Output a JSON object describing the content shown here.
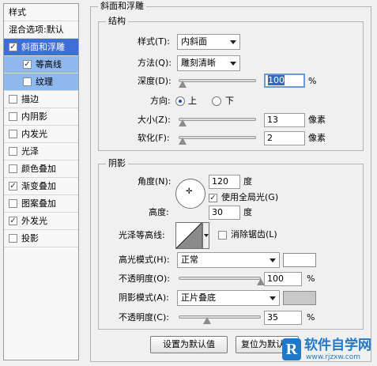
{
  "style_list": {
    "header": "样式",
    "blend_options": "混合选项:默认",
    "items": [
      {
        "label": "斜面和浮雕",
        "checked": true
      },
      {
        "label": "等高线",
        "checked": true
      },
      {
        "label": "纹理",
        "checked": false
      },
      {
        "label": "描边",
        "checked": false
      },
      {
        "label": "内阴影",
        "checked": false
      },
      {
        "label": "内发光",
        "checked": false
      },
      {
        "label": "光泽",
        "checked": false
      },
      {
        "label": "颜色叠加",
        "checked": false
      },
      {
        "label": "渐变叠加",
        "checked": true
      },
      {
        "label": "图案叠加",
        "checked": false
      },
      {
        "label": "外发光",
        "checked": true
      },
      {
        "label": "投影",
        "checked": false
      }
    ]
  },
  "panel_title": "斜面和浮雕",
  "structure": {
    "title": "结构",
    "style_label": "样式(T):",
    "style_value": "内斜面",
    "method_label": "方法(Q):",
    "method_value": "雕刻清晰",
    "depth_label": "深度(D):",
    "depth_value": "100",
    "depth_unit": "%",
    "depth_level": 0.05,
    "direction_label": "方向:",
    "dir_up": "上",
    "dir_down": "下",
    "size_label": "大小(Z):",
    "size_value": "13",
    "size_unit": "像素",
    "size_level": 0.05,
    "soften_label": "软化(F):",
    "soften_value": "2",
    "soften_unit": "像素",
    "soften_level": 0.05
  },
  "shading": {
    "title": "阴影",
    "angle_label": "角度(N):",
    "angle_value": "120",
    "angle_unit": "度",
    "global_light_label": "使用全局光(G)",
    "altitude_label": "高度:",
    "altitude_value": "30",
    "altitude_unit": "度",
    "gloss_label": "光泽等高线:",
    "antialias_label": "消除锯齿(L)",
    "highlight_label": "高光模式(H):",
    "highlight_value": "正常",
    "opacity1_label": "不透明度(O):",
    "opacity1_value": "100",
    "opacity1_unit": "%",
    "opacity1_level": 1.0,
    "shadow_label": "阴影模式(A):",
    "shadow_value": "正片叠底",
    "opacity2_label": "不透明度(C):",
    "opacity2_value": "35",
    "opacity2_unit": "%",
    "opacity2_level": 0.35,
    "highlight_color": "#ffffff",
    "shadow_color": "#c8c8c8"
  },
  "buttons": {
    "make_default": "设置为默认值",
    "reset_default": "复位为默认值"
  },
  "watermark": {
    "brand": "软件自学网",
    "url": "www.rjzxw.com"
  }
}
